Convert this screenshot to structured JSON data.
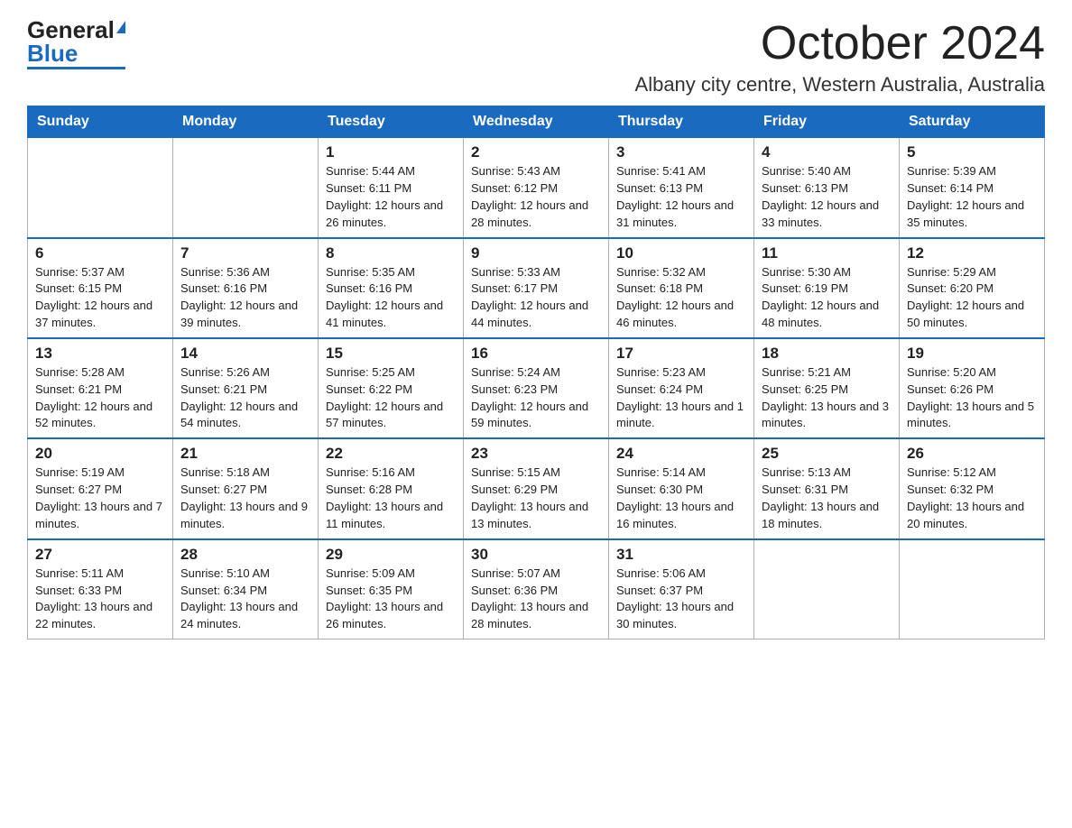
{
  "logo": {
    "general": "General",
    "blue": "Blue"
  },
  "title": "October 2024",
  "subtitle": "Albany city centre, Western Australia, Australia",
  "days_of_week": [
    "Sunday",
    "Monday",
    "Tuesday",
    "Wednesday",
    "Thursday",
    "Friday",
    "Saturday"
  ],
  "weeks": [
    [
      {
        "num": "",
        "info": ""
      },
      {
        "num": "",
        "info": ""
      },
      {
        "num": "1",
        "info": "Sunrise: 5:44 AM\nSunset: 6:11 PM\nDaylight: 12 hours\nand 26 minutes."
      },
      {
        "num": "2",
        "info": "Sunrise: 5:43 AM\nSunset: 6:12 PM\nDaylight: 12 hours\nand 28 minutes."
      },
      {
        "num": "3",
        "info": "Sunrise: 5:41 AM\nSunset: 6:13 PM\nDaylight: 12 hours\nand 31 minutes."
      },
      {
        "num": "4",
        "info": "Sunrise: 5:40 AM\nSunset: 6:13 PM\nDaylight: 12 hours\nand 33 minutes."
      },
      {
        "num": "5",
        "info": "Sunrise: 5:39 AM\nSunset: 6:14 PM\nDaylight: 12 hours\nand 35 minutes."
      }
    ],
    [
      {
        "num": "6",
        "info": "Sunrise: 5:37 AM\nSunset: 6:15 PM\nDaylight: 12 hours\nand 37 minutes."
      },
      {
        "num": "7",
        "info": "Sunrise: 5:36 AM\nSunset: 6:16 PM\nDaylight: 12 hours\nand 39 minutes."
      },
      {
        "num": "8",
        "info": "Sunrise: 5:35 AM\nSunset: 6:16 PM\nDaylight: 12 hours\nand 41 minutes."
      },
      {
        "num": "9",
        "info": "Sunrise: 5:33 AM\nSunset: 6:17 PM\nDaylight: 12 hours\nand 44 minutes."
      },
      {
        "num": "10",
        "info": "Sunrise: 5:32 AM\nSunset: 6:18 PM\nDaylight: 12 hours\nand 46 minutes."
      },
      {
        "num": "11",
        "info": "Sunrise: 5:30 AM\nSunset: 6:19 PM\nDaylight: 12 hours\nand 48 minutes."
      },
      {
        "num": "12",
        "info": "Sunrise: 5:29 AM\nSunset: 6:20 PM\nDaylight: 12 hours\nand 50 minutes."
      }
    ],
    [
      {
        "num": "13",
        "info": "Sunrise: 5:28 AM\nSunset: 6:21 PM\nDaylight: 12 hours\nand 52 minutes."
      },
      {
        "num": "14",
        "info": "Sunrise: 5:26 AM\nSunset: 6:21 PM\nDaylight: 12 hours\nand 54 minutes."
      },
      {
        "num": "15",
        "info": "Sunrise: 5:25 AM\nSunset: 6:22 PM\nDaylight: 12 hours\nand 57 minutes."
      },
      {
        "num": "16",
        "info": "Sunrise: 5:24 AM\nSunset: 6:23 PM\nDaylight: 12 hours\nand 59 minutes."
      },
      {
        "num": "17",
        "info": "Sunrise: 5:23 AM\nSunset: 6:24 PM\nDaylight: 13 hours\nand 1 minute."
      },
      {
        "num": "18",
        "info": "Sunrise: 5:21 AM\nSunset: 6:25 PM\nDaylight: 13 hours\nand 3 minutes."
      },
      {
        "num": "19",
        "info": "Sunrise: 5:20 AM\nSunset: 6:26 PM\nDaylight: 13 hours\nand 5 minutes."
      }
    ],
    [
      {
        "num": "20",
        "info": "Sunrise: 5:19 AM\nSunset: 6:27 PM\nDaylight: 13 hours\nand 7 minutes."
      },
      {
        "num": "21",
        "info": "Sunrise: 5:18 AM\nSunset: 6:27 PM\nDaylight: 13 hours\nand 9 minutes."
      },
      {
        "num": "22",
        "info": "Sunrise: 5:16 AM\nSunset: 6:28 PM\nDaylight: 13 hours\nand 11 minutes."
      },
      {
        "num": "23",
        "info": "Sunrise: 5:15 AM\nSunset: 6:29 PM\nDaylight: 13 hours\nand 13 minutes."
      },
      {
        "num": "24",
        "info": "Sunrise: 5:14 AM\nSunset: 6:30 PM\nDaylight: 13 hours\nand 16 minutes."
      },
      {
        "num": "25",
        "info": "Sunrise: 5:13 AM\nSunset: 6:31 PM\nDaylight: 13 hours\nand 18 minutes."
      },
      {
        "num": "26",
        "info": "Sunrise: 5:12 AM\nSunset: 6:32 PM\nDaylight: 13 hours\nand 20 minutes."
      }
    ],
    [
      {
        "num": "27",
        "info": "Sunrise: 5:11 AM\nSunset: 6:33 PM\nDaylight: 13 hours\nand 22 minutes."
      },
      {
        "num": "28",
        "info": "Sunrise: 5:10 AM\nSunset: 6:34 PM\nDaylight: 13 hours\nand 24 minutes."
      },
      {
        "num": "29",
        "info": "Sunrise: 5:09 AM\nSunset: 6:35 PM\nDaylight: 13 hours\nand 26 minutes."
      },
      {
        "num": "30",
        "info": "Sunrise: 5:07 AM\nSunset: 6:36 PM\nDaylight: 13 hours\nand 28 minutes."
      },
      {
        "num": "31",
        "info": "Sunrise: 5:06 AM\nSunset: 6:37 PM\nDaylight: 13 hours\nand 30 minutes."
      },
      {
        "num": "",
        "info": ""
      },
      {
        "num": "",
        "info": ""
      }
    ]
  ]
}
